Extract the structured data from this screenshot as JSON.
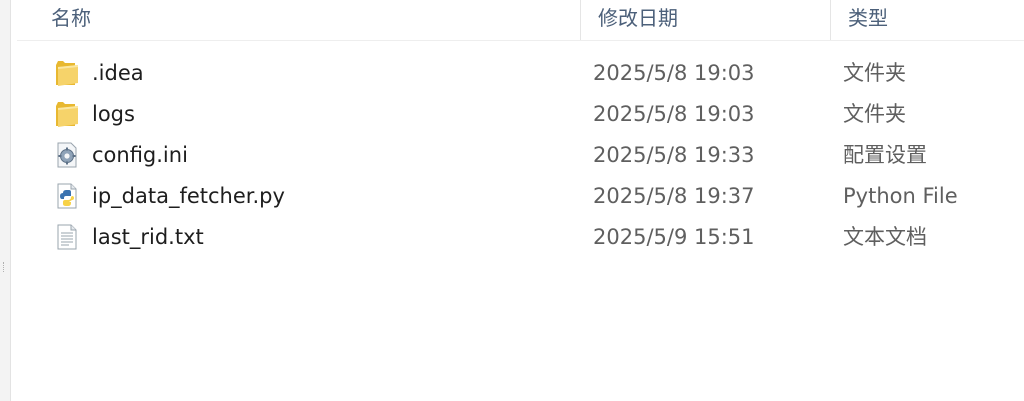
{
  "header": {
    "columns": {
      "name": "名称",
      "date": "修改日期",
      "type": "类型"
    }
  },
  "files": [
    {
      "name": ".idea",
      "date": "2025/5/8 19:03",
      "type": "文件夹",
      "icon": "folder-icon"
    },
    {
      "name": "logs",
      "date": "2025/5/8 19:03",
      "type": "文件夹",
      "icon": "folder-icon"
    },
    {
      "name": "config.ini",
      "date": "2025/5/8 19:33",
      "type": "配置设置",
      "icon": "config-settings-icon"
    },
    {
      "name": "ip_data_fetcher.py",
      "date": "2025/5/8 19:37",
      "type": "Python File",
      "icon": "python-file-icon"
    },
    {
      "name": "last_rid.txt",
      "date": "2025/5/9 15:51",
      "type": "文本文档",
      "icon": "text-document-icon"
    }
  ],
  "colors": {
    "header_text": "#4c607a",
    "folder": "#f2c94c",
    "python_blue": "#3a73b0",
    "python_yellow": "#f7d247"
  }
}
